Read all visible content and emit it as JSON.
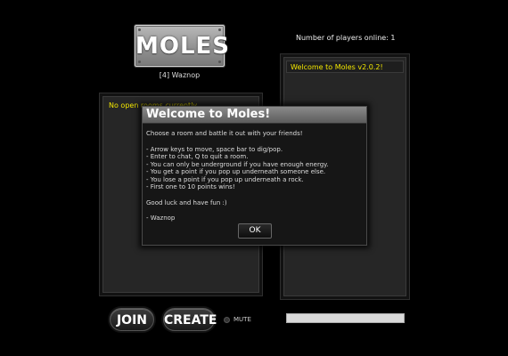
{
  "logo": {
    "title": "MOLES"
  },
  "user": {
    "display": "[4] Waznop"
  },
  "status": {
    "players_online": "Number of players online: 1"
  },
  "rooms": {
    "empty_message": "No open rooms currently"
  },
  "chat": {
    "messages": [
      "Welcome to Moles v2.0.2!"
    ],
    "input_value": ""
  },
  "buttons": {
    "join": "JOIN",
    "create": "CREATE",
    "mute": "MUTE"
  },
  "dialog": {
    "title": "Welcome to Moles!",
    "intro": "Choose a room and battle it out with your friends!",
    "rules": [
      "- Arrow keys to move, space bar to dig/pop.",
      "- Enter to chat, Q to quit a room.",
      "- You can only be underground if you have enough energy.",
      "- You get a point if you pop up underneath someone else.",
      "- You lose a point if you pop up underneath a rock.",
      "- First one to 10 points wins!"
    ],
    "closing": "Good luck and have fun :)",
    "signature": "- Waznop",
    "ok": "OK"
  },
  "colors": {
    "highlight_text": "#f2e600",
    "background": "#000000"
  }
}
